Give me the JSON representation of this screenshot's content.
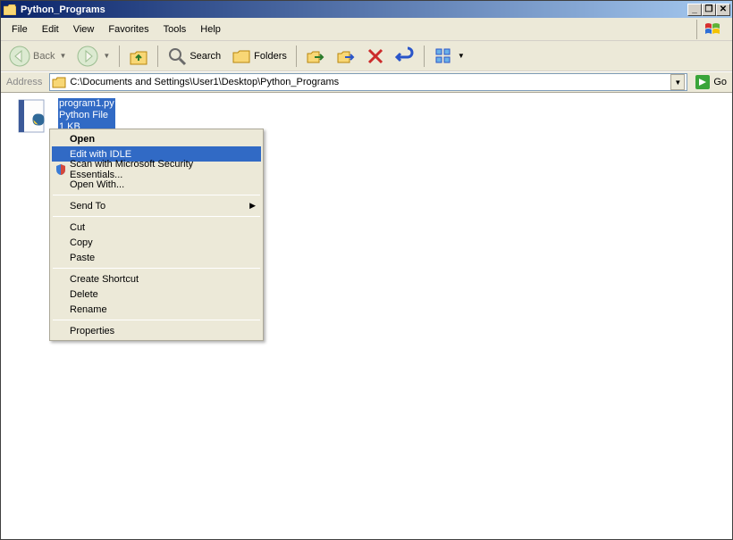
{
  "window": {
    "title": "Python_Programs"
  },
  "menu": {
    "file": "File",
    "edit": "Edit",
    "view": "View",
    "favorites": "Favorites",
    "tools": "Tools",
    "help": "Help"
  },
  "toolbar": {
    "back": "Back",
    "search": "Search",
    "folders": "Folders"
  },
  "address": {
    "label": "Address",
    "path": "C:\\Documents and Settings\\User1\\Desktop\\Python_Programs",
    "go": "Go"
  },
  "file": {
    "name": "program1.py",
    "type": "Python File",
    "size": "1 KB"
  },
  "ctx": {
    "open": "Open",
    "edit_idle": "Edit with IDLE",
    "scan": "Scan with Microsoft Security Essentials...",
    "open_with": "Open With...",
    "send_to": "Send To",
    "cut": "Cut",
    "copy": "Copy",
    "paste": "Paste",
    "shortcut": "Create Shortcut",
    "delete": "Delete",
    "rename": "Rename",
    "properties": "Properties"
  }
}
